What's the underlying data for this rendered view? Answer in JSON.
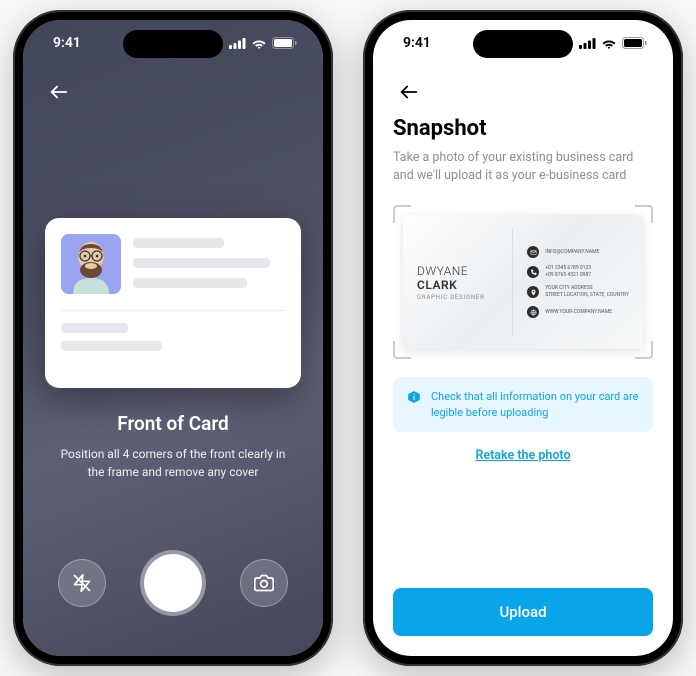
{
  "status": {
    "time": "9:41"
  },
  "screen1": {
    "title": "Front of Card",
    "subtitle": "Position all 4 corners of the front clearly in the frame and remove any cover"
  },
  "screen2": {
    "title": "Snapshot",
    "subtitle": "Take a photo of your existing business card and we'll upload it as your e-business card",
    "card": {
      "first_name": "DWYANE",
      "last_name": "CLARK",
      "role": "GRAPHIC DESIGNER",
      "email": "INFO@COMPANY.NAME",
      "phone1": "+01 2345 6789 0123",
      "phone2": "+09 8765 4321 0987",
      "address1": "YOUR CITY ADDRESS",
      "address2": "STREET LOCATION, STATE, COUNTRY",
      "website": "WWW.YOUR-COMPANY.NAME"
    },
    "banner": "Check that all information on your card are legible before uploading",
    "retake": "Retake the photo",
    "upload": "Upload"
  }
}
